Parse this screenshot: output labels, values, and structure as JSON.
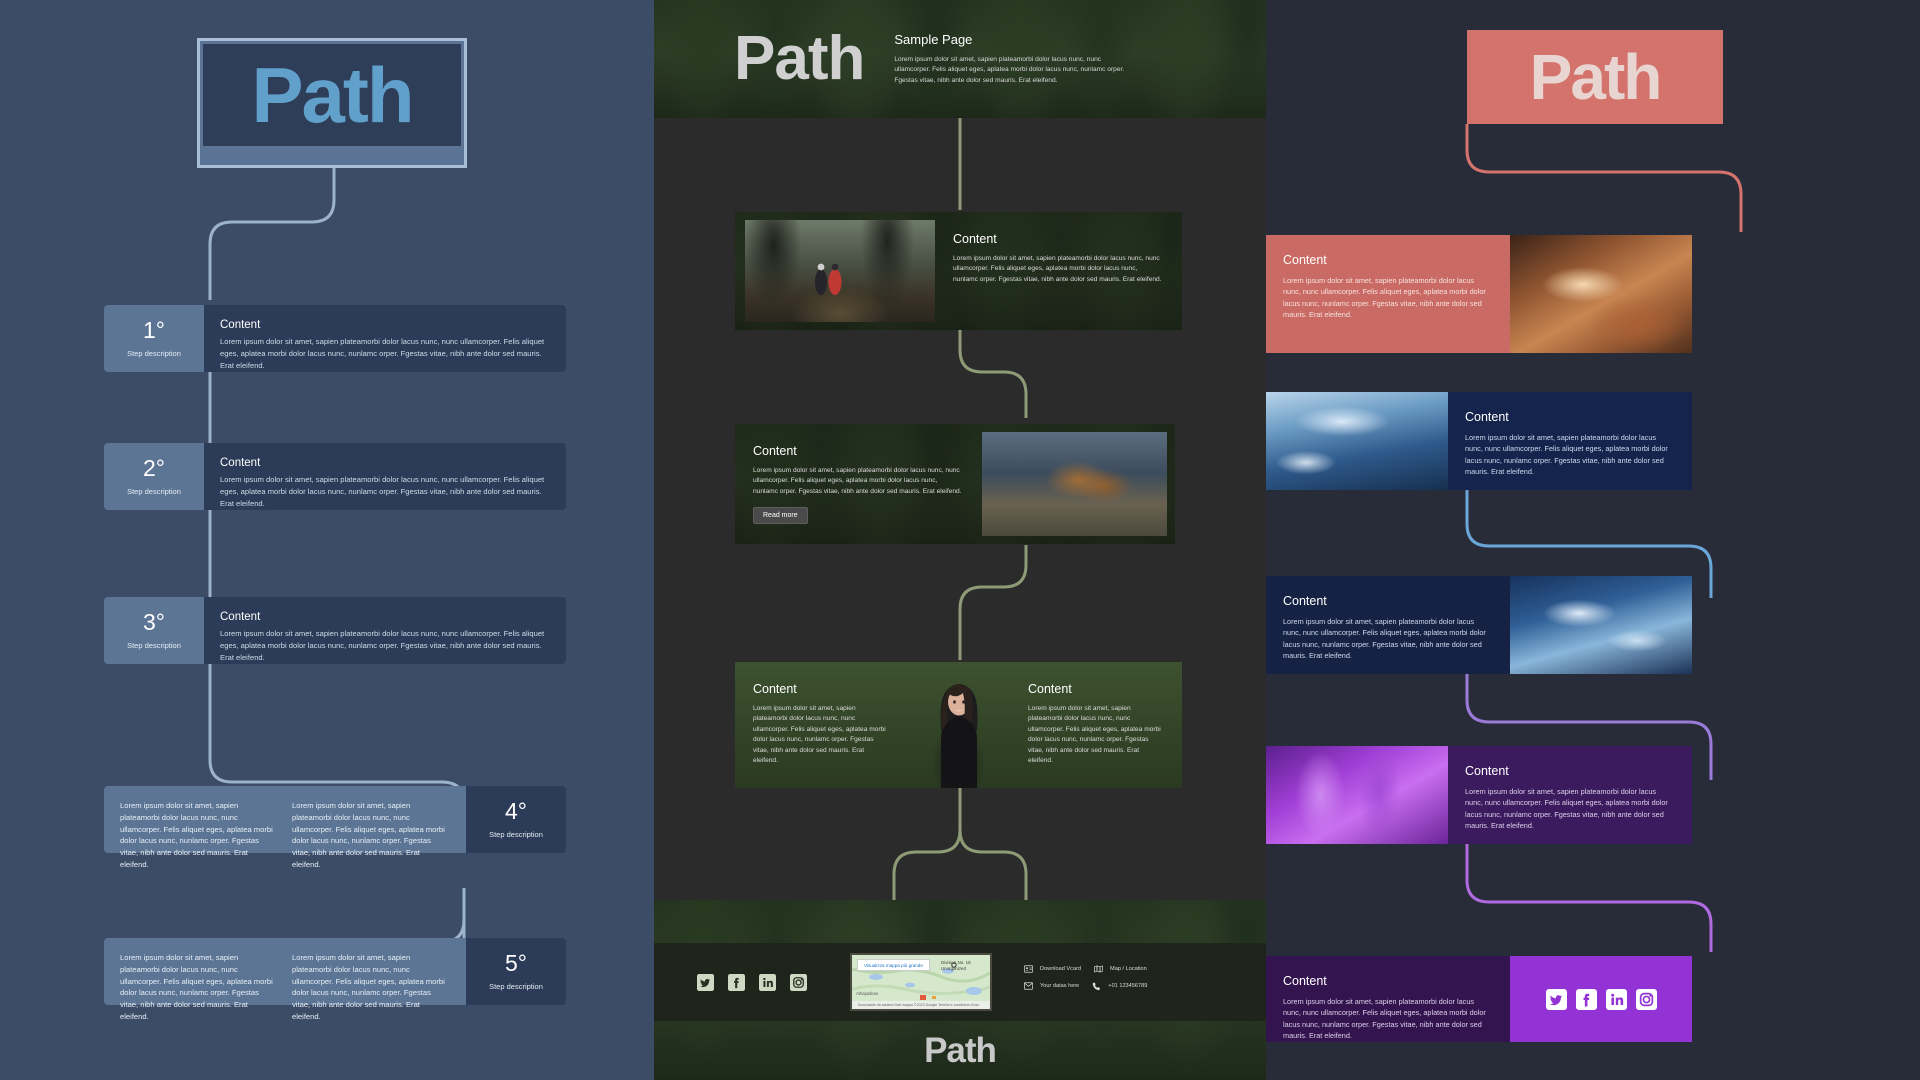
{
  "brand": {
    "name": "Path"
  },
  "lorem": {
    "full": "Lorem ipsum dolor sit amet, sapien plateamorbi dolor lacus nunc, nunc ullamcorper. Felis aliquet eges, aplatea morbi dolor lacus nunc, nunlamc orper. Fgestas vitae, nibh ante dolor sed mauris. Erat eleifend.",
    "short": "Lorem ipsum dolor sit amet, sapien plateamorbi dolor lacus nunc, nunc ullamcorper. Felis aliquet eges, aplatea morbi dolor lacus nunc, nunlamc orper. Fgestas vitae, nibh ante dolor sed mauris. Erat eleifend."
  },
  "left_panel": {
    "logo": "Path",
    "accent": "#62a0cc",
    "badge_bg": "#5d7595",
    "body_bg": "#2c3b57",
    "steps": [
      {
        "num": "1°",
        "desc": "Step description",
        "heading": "Content",
        "layout": "badge-left"
      },
      {
        "num": "2°",
        "desc": "Step description",
        "heading": "Content",
        "layout": "badge-left"
      },
      {
        "num": "3°",
        "desc": "Step description",
        "heading": "Content",
        "layout": "badge-left"
      },
      {
        "num": "4°",
        "desc": "Step description",
        "heading": "",
        "layout": "badge-right"
      },
      {
        "num": "5°",
        "desc": "Step description",
        "heading": "",
        "layout": "badge-right"
      }
    ]
  },
  "center_panel": {
    "logo": "Path",
    "header": {
      "title": "Sample Page",
      "body": "Lorem ipsum dolor sit amet, sapien plateamorbi dolor lacus nunc, nunc ullamcorper. Felis aliquet eges, aplatea morbi dolor lacus nunc, nunlamc orper. Fgestas vitae, nibh ante dolor sed mauris. Erat eleifend."
    },
    "cards": [
      {
        "heading": "Content",
        "body": "Lorem ipsum dolor sit amet, sapien plateamorbi dolor lacus nunc, nunc ullamcorper. Felis aliquet eges, aplatea morbi dolor lacus nunc, nunlamc orper. Fgestas vitae, nibh ante dolor sed mauris. Erat eleifend.",
        "image": "forest-path-hikers",
        "image_side": "left",
        "button": null
      },
      {
        "heading": "Content",
        "body": "Lorem ipsum dolor sit amet, sapien plateamorbi dolor lacus nunc, nunc ullamcorper. Felis aliquet eges, aplatea morbi dolor lacus nunc, nunlamc orper. Fgestas vitae, nibh ante dolor sed mauris. Erat eleifend.",
        "image": "hiking-boots",
        "image_side": "right",
        "button": "Read more"
      },
      {
        "heading": "Content",
        "body": "Lorem ipsum dolor sit amet, sapien plateamorbi dolor lacus nunc, nunc ullamcorper. Felis aliquet eges, aplatea morbi dolor lacus nunc, nunlamc orper. Fgestas vitae, nibh ante dolor sed mauris. Erat eleifend.",
        "image": "portrait-woman",
        "image_side": "center",
        "button": null
      },
      {
        "heading": "Content",
        "body": "Lorem ipsum dolor sit amet, sapien plateamorbi dolor lacus nunc, nunc ullamcorper. Felis aliquet eges, aplatea morbi dolor lacus nunc, nunlamc orper. Fgestas vitae, nibh ante dolor sed mauris. Erat eleifend."
      }
    ],
    "footer": {
      "social": [
        "twitter-icon",
        "facebook-icon",
        "linkedin-icon",
        "instagram-icon"
      ],
      "map": {
        "button": "Visualizza mappa più grande",
        "marker": "Division No. 18 Unorganized",
        "place": "Athapaskan",
        "credits": "Scorciatoie da tastiera   Dati mappa ©2023 Google   Termini e condizioni d'uso"
      },
      "info": [
        {
          "icon": "vcard-icon",
          "label": "Download Vcard"
        },
        {
          "icon": "map-icon",
          "label": "Map / Location"
        },
        {
          "icon": "mail-icon",
          "label": "Your datas here"
        },
        {
          "icon": "phone-icon",
          "label": "+01 123456789"
        }
      ],
      "big_logo": "Path"
    }
  },
  "right_panel": {
    "logo": "Path",
    "logo_bg": "#d4736c",
    "cards": [
      {
        "heading": "Content",
        "body": "Lorem ipsum dolor sit amet, sapien plateamorbi dolor lacus nunc, nunc ullamcorper. Felis aliquet eges, aplatea morbi dolor lacus nunc, nunlamc orper. Fgestas vitae, nibh ante dolor sed mauris. Erat eleifend.",
        "bg": "#c96b64",
        "text_color": "#f6e2e0",
        "image": "canyon",
        "image_side": "right"
      },
      {
        "heading": "Content",
        "body": "Lorem ipsum dolor sit amet, sapien plateamorbi dolor lacus nunc, nunc ullamcorper. Felis aliquet eges, aplatea morbi dolor lacus nunc, nunlamc orper. Fgestas vitae, nibh ante dolor sed mauris. Erat eleifend.",
        "bg": "#14244d",
        "text_color": "#cfdaee",
        "image": "mountain",
        "image_side": "left"
      },
      {
        "heading": "Content",
        "body": "Lorem ipsum dolor sit amet, sapien plateamorbi dolor lacus nunc, nunc ullamcorper. Felis aliquet eges, aplatea morbi dolor lacus nunc, nunlamc orper. Fgestas vitae, nibh ante dolor sed mauris. Erat eleifend.",
        "bg": "#152243",
        "text_color": "#cfdaee",
        "image": "water",
        "image_side": "right"
      },
      {
        "heading": "Content",
        "body": "Lorem ipsum dolor sit amet, sapien plateamorbi dolor lacus nunc, nunc ullamcorper. Felis aliquet eges, aplatea morbi dolor lacus nunc, nunlamc orper. Fgestas vitae, nibh ante dolor sed mauris. Erat eleifend.",
        "bg": "#3b1a5e",
        "text_color": "#ddd2ea",
        "image": "purple-feathers",
        "image_side": "left"
      },
      {
        "heading": "Content",
        "body": "Lorem ipsum dolor sit amet, sapien plateamorbi dolor lacus nunc, nunc ullamcorper. Felis aliquet eges, aplatea morbi dolor lacus nunc, nunlamc orper. Fgestas vitae, nibh ante dolor sed mauris. Erat eleifend.",
        "bg": "#33144f",
        "text_color": "#ddd2ea",
        "image": "social-block",
        "image_side": "right",
        "social": [
          "twitter-icon",
          "facebook-icon",
          "linkedin-icon",
          "instagram-icon"
        ]
      }
    ],
    "connector_colors": [
      "#d4736c",
      "#6ba6d8",
      "#6ba6d8",
      "#b06ae0"
    ]
  }
}
